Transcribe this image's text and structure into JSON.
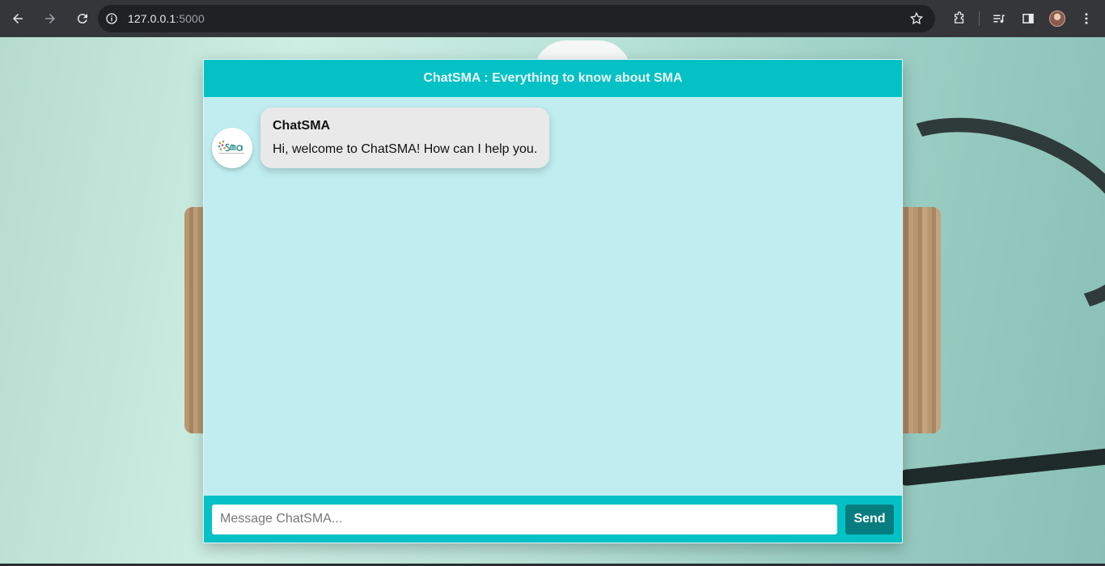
{
  "browser": {
    "url_host": "127.0.0.1",
    "url_port": ":5000",
    "icons": [
      "back-arrow-icon",
      "forward-arrow-icon",
      "reload-icon",
      "site-info-icon",
      "bookmark-star-icon",
      "extensions-icon",
      "media-queue-icon",
      "side-panel-icon",
      "profile-avatar",
      "kebab-menu-icon"
    ]
  },
  "chat": {
    "title": "ChatSMA : Everything to know about SMA",
    "messages": [
      {
        "sender": "ChatSMA",
        "text": "Hi, welcome to ChatSMA! How can I help you."
      }
    ],
    "input_placeholder": "Message ChatSMA...",
    "send_label": "Send"
  },
  "colors": {
    "header": "#04c1c6",
    "body": "#c0eef0",
    "bubble": "#e9e9e9",
    "send_button": "#067d7f"
  }
}
